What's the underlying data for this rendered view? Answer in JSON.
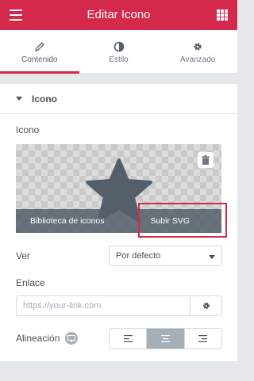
{
  "header": {
    "title": "Editar Icono",
    "menu_icon": "hamburger-icon",
    "apps_icon": "grid-icon"
  },
  "tabs": [
    {
      "label": "Contenido",
      "icon": "pencil-icon",
      "active": true
    },
    {
      "label": "Estilo",
      "icon": "half-circle-icon",
      "active": false
    },
    {
      "label": "Avanzado",
      "icon": "gear-icon",
      "active": false
    }
  ],
  "section": {
    "title": "Icono"
  },
  "icon_field": {
    "label": "Icono",
    "library_button": "Biblioteca de iconos",
    "upload_button": "Subir SVG",
    "preview_icon": "star-icon"
  },
  "view_field": {
    "label": "Ver",
    "value": "Por defecto"
  },
  "link_field": {
    "label": "Enlace",
    "placeholder": "https://your-link.com"
  },
  "alignment": {
    "label": "Alineación",
    "selected": "center"
  },
  "colors": {
    "accent": "#d5294b",
    "panel_bg": "#e6e9ec"
  }
}
